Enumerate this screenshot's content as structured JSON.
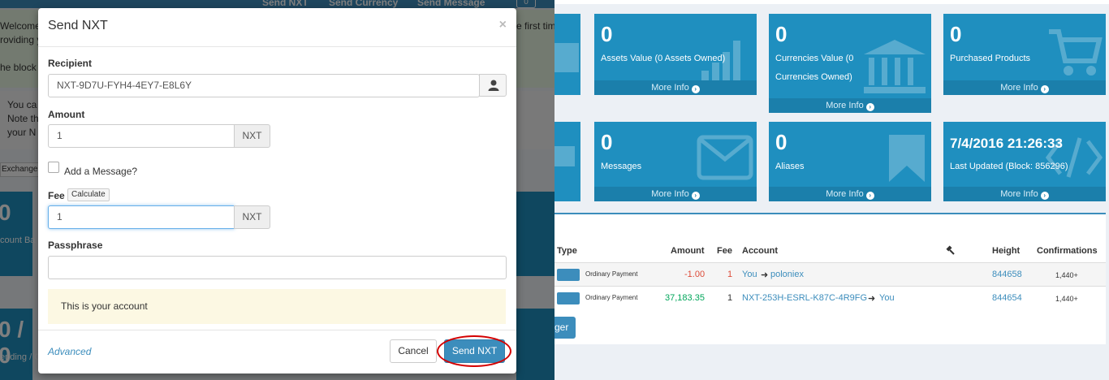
{
  "top_nav": {
    "send_nxt": "Send NXT",
    "send_currency": "Send Currency",
    "send_message": "Send Message",
    "badge": "0"
  },
  "left_bg": {
    "welcome_lines": [
      "Welcome",
      "roviding y",
      "he block"
    ],
    "welcome_right": "e first tim",
    "note_lines": [
      "You ca",
      "Note th",
      "your N"
    ],
    "exchange_tab": "Exchange",
    "card_big_1": "0",
    "card_sub_1": "count Ba",
    "card_big_2": "0 / 0",
    "card_sub_2": "ending / C"
  },
  "modal": {
    "title": "Send NXT",
    "close_label": "×",
    "recipient_label": "Recipient",
    "recipient_value": "NXT-9D7U-FYH4-4EY7-E8L6Y",
    "amount_label": "Amount",
    "amount_value": "1",
    "amount_unit": "NXT",
    "add_message_label": "Add a Message?",
    "fee_label": "Fee",
    "calculate_label": "Calculate",
    "fee_value": "1",
    "fee_unit": "NXT",
    "passphrase_label": "Passphrase",
    "passphrase_value": "",
    "info_text": "This is your account",
    "advanced_label": "Advanced",
    "cancel_label": "Cancel",
    "send_label": "Send NXT"
  },
  "cards_row1": [
    {
      "value": "0",
      "desc": "Assets Value (0 Assets Owned)",
      "more": "More Info",
      "icon": "bar-chart-icon"
    },
    {
      "value": "0",
      "desc": "Currencies Value (0 Currencies Owned)",
      "more": "More Info",
      "icon": "bank-icon"
    },
    {
      "value": "0",
      "desc": "Purchased Products",
      "more": "More Info",
      "icon": "cart-icon"
    }
  ],
  "cards_row2": [
    {
      "value": "0",
      "desc": "Messages",
      "more": "More Info",
      "icon": "envelope-icon"
    },
    {
      "value": "0",
      "desc": "Aliases",
      "more": "More Info",
      "icon": "bookmark-icon"
    },
    {
      "value": "7/4/2016 21:26:33",
      "desc": "Last Updated (Block: 856296)",
      "more": "More Info",
      "icon": "code-icon"
    }
  ],
  "transactions": {
    "headers": {
      "type": "Type",
      "amount": "Amount",
      "fee": "Fee",
      "account": "Account",
      "height": "Height",
      "confirmations": "Confirmations"
    },
    "rows": [
      {
        "type": "Ordinary Payment",
        "amount": "-1.00",
        "fee": "1",
        "account_from": "You",
        "account_to": "poloniex",
        "height": "844658",
        "confirmations": "1,440+"
      },
      {
        "type": "Ordinary Payment",
        "amount": "37,183.35",
        "fee": "1",
        "account_from": "NXT-253H-ESRL-K87C-4R9FG",
        "account_to": "You",
        "height": "844654",
        "confirmations": "1,440+"
      }
    ],
    "ledger_btn": "ger"
  },
  "colors": {
    "primary": "#3c8dbc",
    "card": "#1f8fbf",
    "negative": "#dd4b39",
    "positive": "#00a65a",
    "highlight_ring": "#d40000"
  }
}
